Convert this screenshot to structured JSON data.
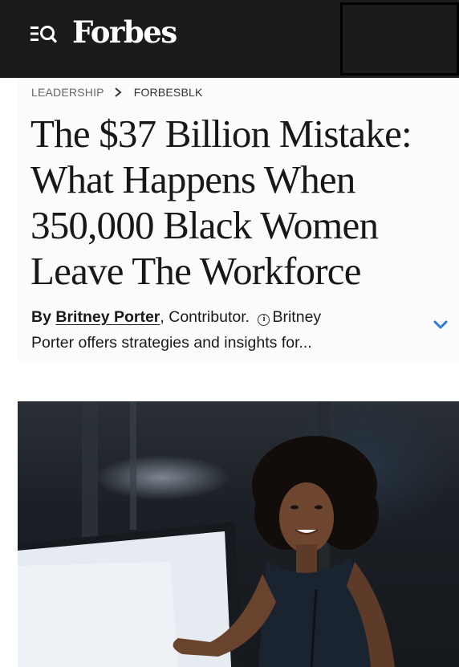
{
  "header": {
    "logo": "Forbes",
    "menu_search_icon": "menu-search-icon"
  },
  "breadcrumb": {
    "items": [
      "LEADERSHIP",
      "FORBESBLK"
    ],
    "separator_icon": "chevron-right-icon"
  },
  "article": {
    "headline_lines": [
      "The $37 Billion Mistake:",
      "What Happens When",
      "350,000 Black Women",
      "Leave The Workforce"
    ],
    "byline": {
      "prefix": "By",
      "author": "Britney Porter",
      "role": ", Contributor.",
      "info_icon": "info-icon",
      "bio_start": "Britney",
      "bio_line2": "Porter offers strategies and insights for...",
      "expand_icon": "chevron-down-icon"
    }
  },
  "hero_image": {
    "icon": "photo-of-woman-presenting-at-screen"
  },
  "colors": {
    "header_bg": "#1b1b1b",
    "accent_blue": "#2b7bd8",
    "text": "#181818"
  }
}
